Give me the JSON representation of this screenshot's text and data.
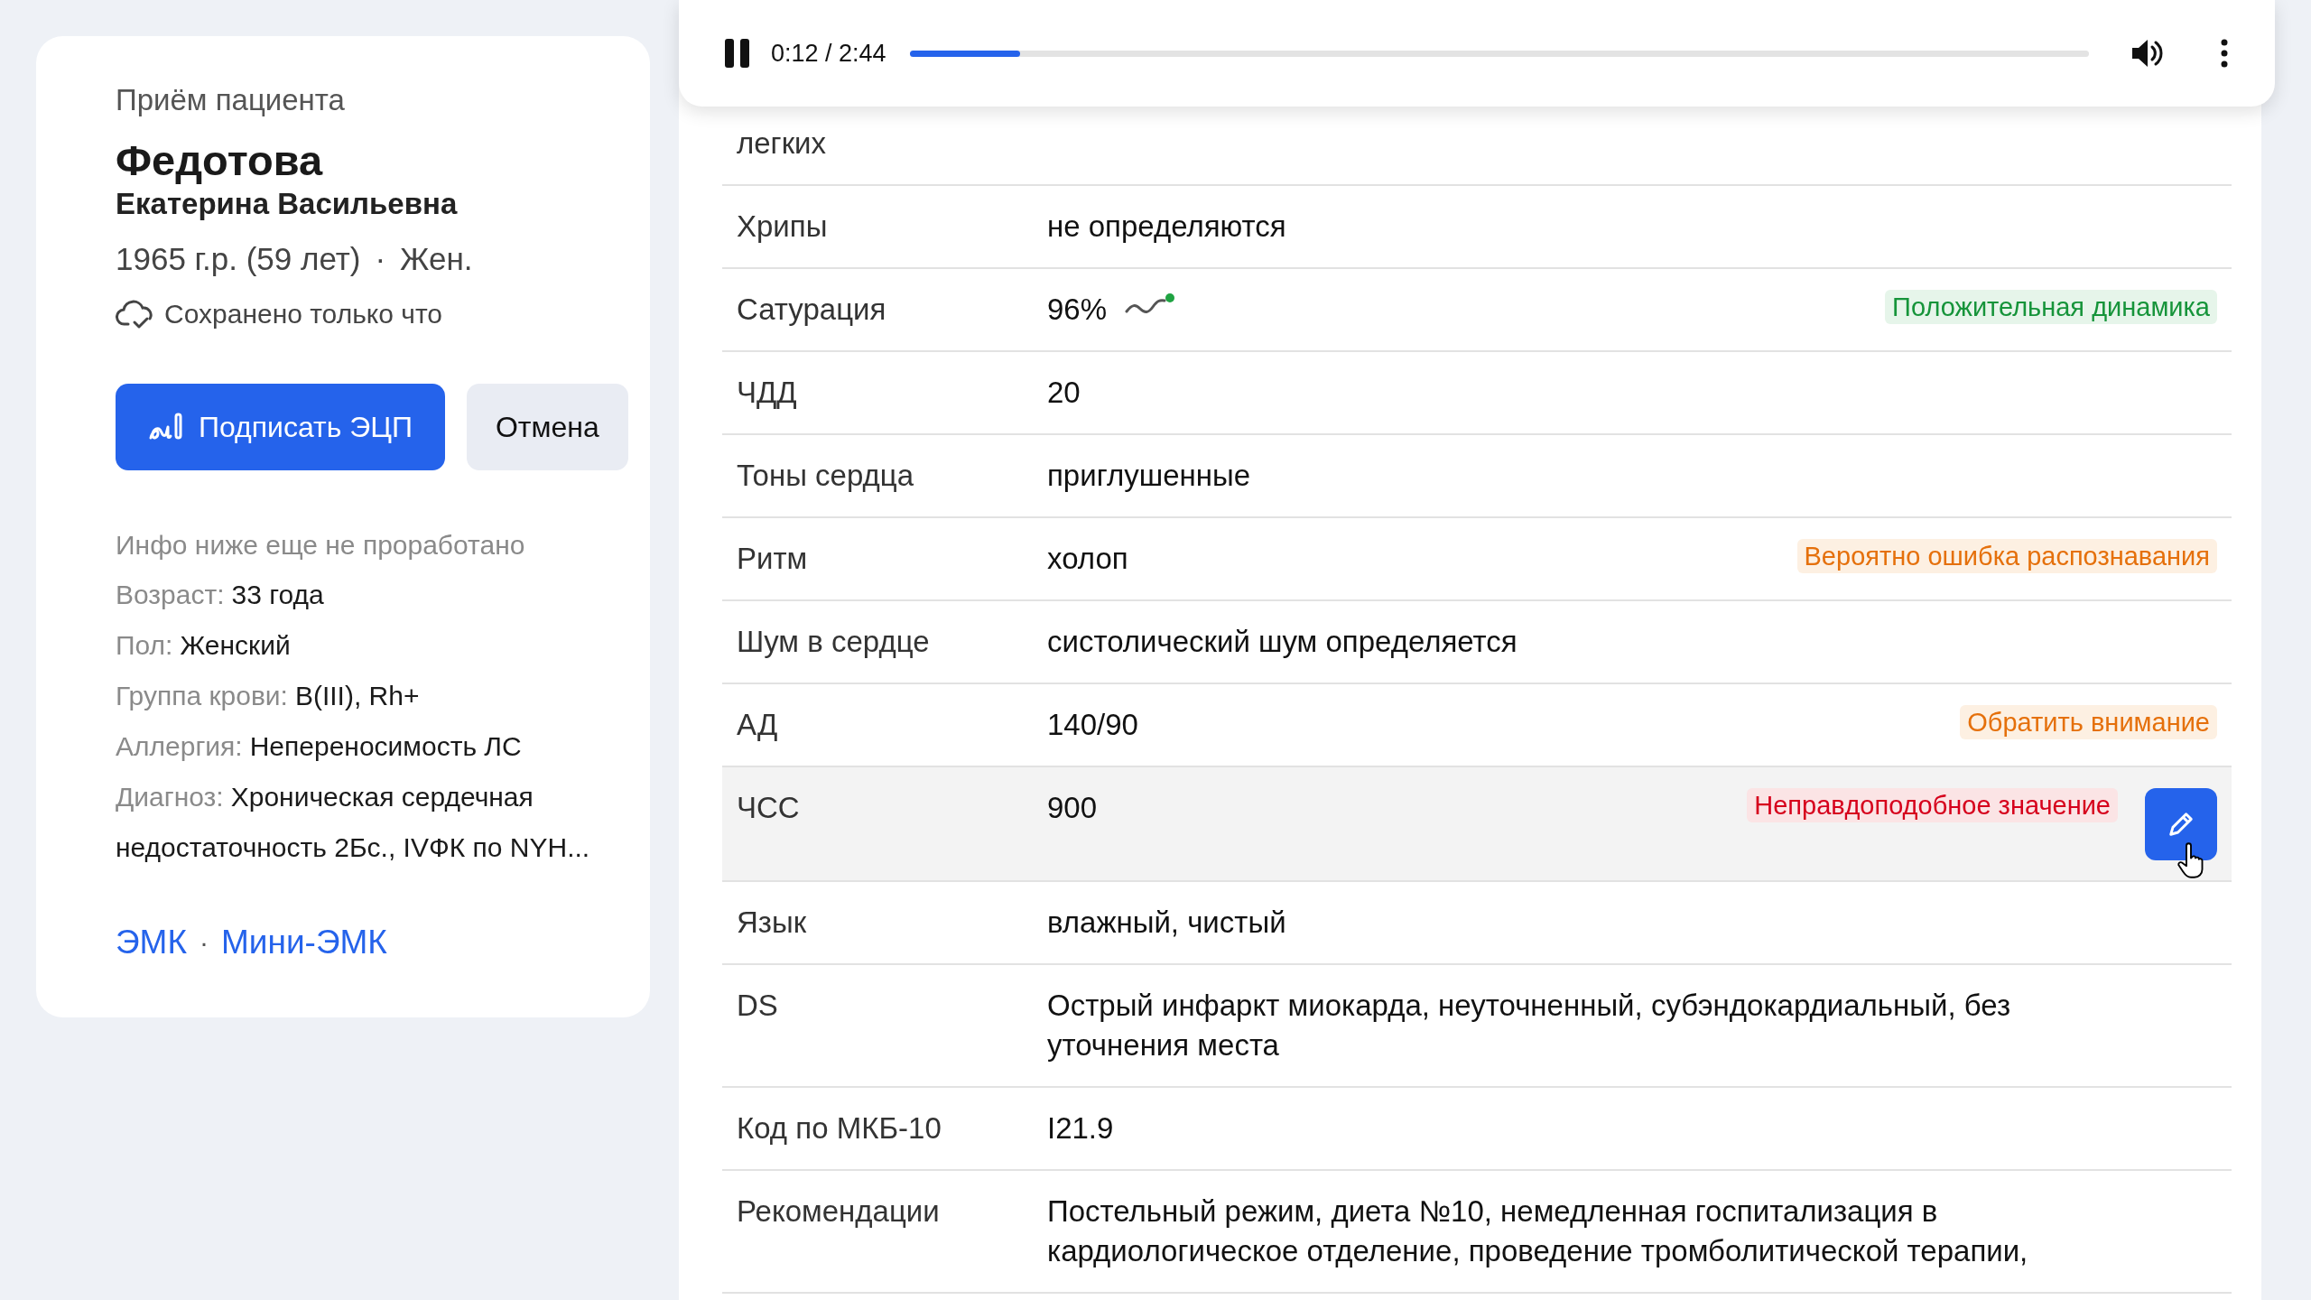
{
  "patient_card": {
    "heading": "Приём пациента",
    "surname": "Федотова",
    "given_names": "Екатерина Васильевна",
    "birth_info": "1965 г.р. (59 лет)",
    "separator": "·",
    "gender": "Жен.",
    "save_status": "Сохранено только что",
    "buttons": [
      {
        "label": "Подписать ЭЦП",
        "kind": "primary"
      },
      {
        "label": "Отмена",
        "kind": "secondary"
      }
    ],
    "info_note": "Инфо ниже еще не проработано",
    "info": [
      {
        "label": "Возраст:",
        "value": "33 года"
      },
      {
        "label": "Пол:",
        "value": "Женский"
      },
      {
        "label": "Группа крови:",
        "value": "B(III), Rh+"
      },
      {
        "label": "Аллергия:",
        "value": "Непереносимость ЛС"
      },
      {
        "label": "Диагноз:",
        "value": "Хроническая сердечная недостаточность 2Бс., IVФК по NYH..."
      }
    ],
    "links": [
      "ЭМК",
      "Мини-ЭМК"
    ],
    "links_separator": "·"
  },
  "player": {
    "time": "0:12 / 2:44",
    "level": 0.094
  },
  "table": {
    "rows": [
      {
        "label": "легких",
        "selected": false
      },
      {
        "label": "Хрипы",
        "value": "не определяются",
        "selected": false
      },
      {
        "label": "Сатурация",
        "value": "96%",
        "trend_up": true,
        "badge": {
          "text": "Положительная динамика",
          "kind": "positive"
        },
        "selected": false
      },
      {
        "label": "ЧДД",
        "value": "20",
        "selected": false
      },
      {
        "label": "Тоны сердца",
        "value": "приглушенные",
        "selected": false
      },
      {
        "label": "Ритм",
        "value": "холоп",
        "badge": {
          "text": "Вероятно ошибка распознавания",
          "kind": "warning"
        },
        "selected": false
      },
      {
        "label": "Шум в сердце",
        "value": "систолический шум определяется",
        "selected": false
      },
      {
        "label": "АД",
        "value": "140/90",
        "badge": {
          "text": "Обратить внимание",
          "kind": "warning"
        },
        "selected": false
      },
      {
        "label": "ЧСС",
        "value": "900",
        "badge": {
          "text": "Неправдоподобное значение",
          "kind": "error"
        },
        "selected": true
      },
      {
        "label": "Язык",
        "value": "влажный, чистый",
        "selected": false
      },
      {
        "label": "DS",
        "value": "Острый инфаркт миокарда, неуточненный, субэндокардиальный, без уточнения места",
        "selected": false
      },
      {
        "label": "Код по МКБ-10",
        "value": "I21.9",
        "selected": false
      },
      {
        "label": "Рекомендации",
        "value": "Постельный режим, диета №10, немедленная госпитализация в кардиологическое отделение, проведение тромболитической терапии,",
        "selected": false
      }
    ]
  }
}
